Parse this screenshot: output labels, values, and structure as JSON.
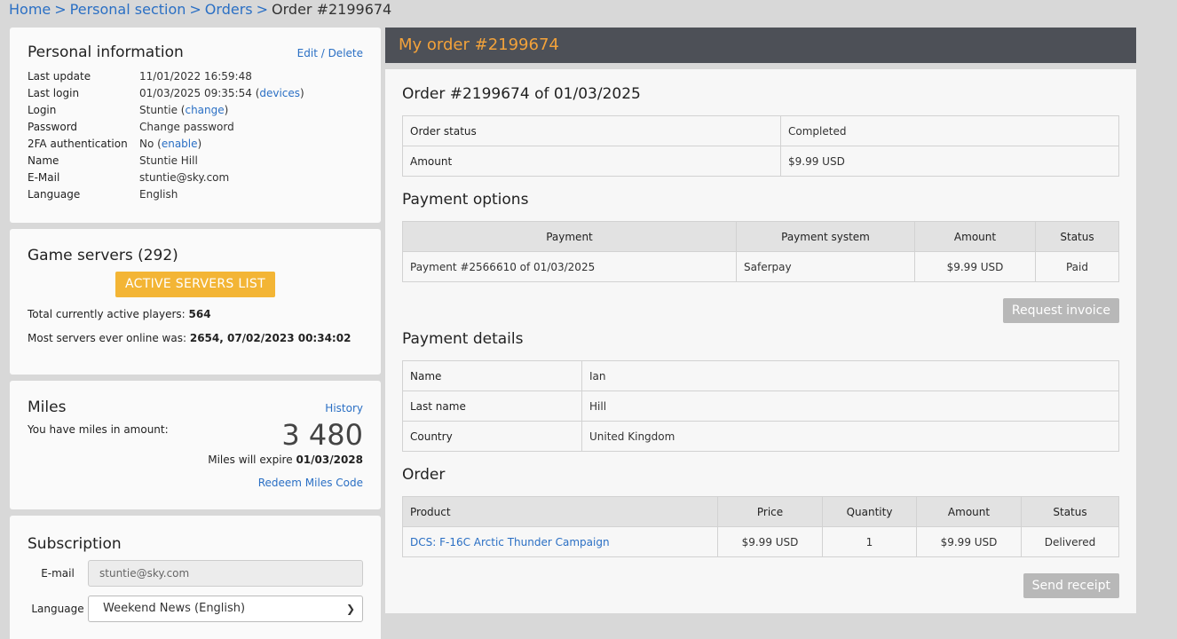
{
  "breadcrumb": {
    "items": [
      "Home",
      "Personal section",
      "Orders"
    ],
    "current": "Order #2199674",
    "separator": ">"
  },
  "personal": {
    "title": "Personal information",
    "edit_link": "Edit / Delete",
    "rows": [
      {
        "label": "Last update",
        "value": "11/01/2022 16:59:48"
      },
      {
        "label": "Last login",
        "value": "01/03/2025 09:35:54",
        "link": "devices"
      },
      {
        "label": "Login",
        "value": "Stuntie",
        "link": "change"
      },
      {
        "label": "Password",
        "link_only": "Change password"
      },
      {
        "label": "2FA authentication",
        "value": "No",
        "link": "enable"
      },
      {
        "label": "Name",
        "value": "Stuntie Hill"
      },
      {
        "label": "E-Mail",
        "value": "stuntie@sky.com"
      },
      {
        "label": "Language",
        "value": "English"
      }
    ]
  },
  "servers": {
    "title": "Game servers (292)",
    "button": "ACTIVE SERVERS LIST",
    "players_label": "Total currently active players:",
    "players_value": "564",
    "max_label": "Most servers ever online was:",
    "max_value": "2654, 07/02/2023 00:34:02"
  },
  "miles": {
    "title": "Miles",
    "history_link": "History",
    "amount_label": "You have miles in amount:",
    "amount": "3 480",
    "expire_label": "Miles will expire",
    "expire_date": "01/03/2028",
    "redeem_link": "Redeem Miles Code"
  },
  "subscription": {
    "title": "Subscription",
    "email_label": "E-mail",
    "email_value": "stuntie@sky.com",
    "language_label": "Language",
    "language_value": "Weekend News (English)"
  },
  "main": {
    "header": "My order #2199674",
    "order_title": "Order #2199674 of 01/03/2025",
    "status_rows": [
      {
        "label": "Order status",
        "value": "Completed"
      },
      {
        "label": "Amount",
        "value": "$9.99 USD"
      }
    ],
    "payment_options_title": "Payment options",
    "payment_headers": [
      "Payment",
      "Payment system",
      "Amount",
      "Status"
    ],
    "payment_rows": [
      [
        "Payment #2566610 of 01/03/2025",
        "Saferpay",
        "$9.99 USD",
        "Paid"
      ]
    ],
    "request_invoice": "Request invoice",
    "payment_details_title": "Payment details",
    "details_rows": [
      {
        "label": "Name",
        "value": "Ian"
      },
      {
        "label": "Last name",
        "value": "Hill"
      },
      {
        "label": "Country",
        "value": "United Kingdom"
      }
    ],
    "order_section_title": "Order",
    "order_headers": [
      "Product",
      "Price",
      "Quantity",
      "Amount",
      "Status"
    ],
    "order_rows": [
      [
        "DCS: F-16C Arctic Thunder Campaign",
        "$9.99 USD",
        "1",
        "$9.99 USD",
        "Delivered"
      ]
    ],
    "send_receipt": "Send receipt"
  }
}
